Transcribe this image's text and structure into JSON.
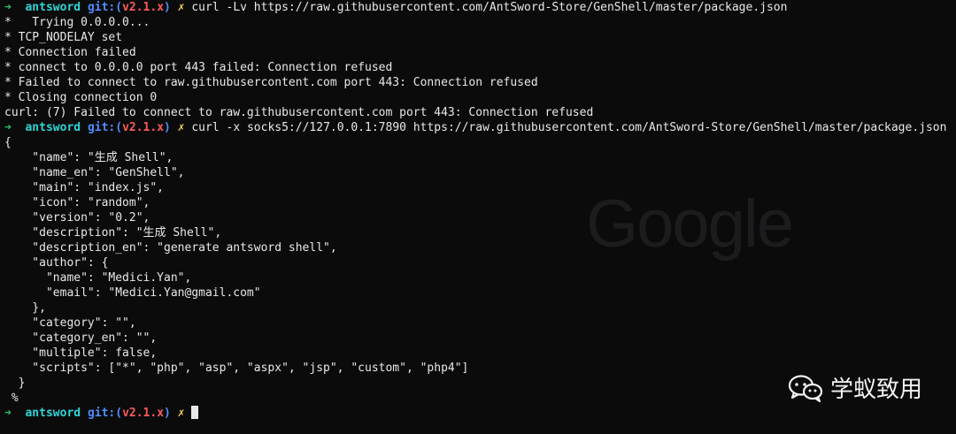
{
  "terminal": {
    "prompt": {
      "arrow": "➜",
      "user": "antsword",
      "git_label": "git:(",
      "branch": "v2.1.x",
      "git_close": ")",
      "mark": "✗"
    },
    "cmd1": "curl -Lv https://raw.githubusercontent.com/AntSword-Store/GenShell/master/package.json",
    "out1": [
      "*   Trying 0.0.0.0...",
      "* TCP_NODELAY set",
      "* Connection failed",
      "* connect to 0.0.0.0 port 443 failed: Connection refused",
      "* Failed to connect to raw.githubusercontent.com port 443: Connection refused",
      "* Closing connection 0",
      "curl: (7) Failed to connect to raw.githubusercontent.com port 443: Connection refused"
    ],
    "cmd2": "curl -x socks5://127.0.0.1:7890 https://raw.githubusercontent.com/AntSword-Store/GenShell/master/package.json",
    "out2": [
      "{",
      "    \"name\": \"生成 Shell\",",
      "    \"name_en\": \"GenShell\",",
      "    \"main\": \"index.js\",",
      "    \"icon\": \"random\",",
      "    \"version\": \"0.2\",",
      "    \"description\": \"生成 Shell\",",
      "    \"description_en\": \"generate antsword shell\",",
      "    \"author\": {",
      "      \"name\": \"Medici.Yan\",",
      "      \"email\": \"Medici.Yan@gmail.com\"",
      "    },",
      "    \"category\": \"\",",
      "    \"category_en\": \"\",",
      "    \"multiple\": false,",
      "    \"scripts\": [\"*\", \"php\", \"asp\", \"aspx\", \"jsp\", \"custom\", \"php4\"]",
      "  }",
      " %"
    ]
  },
  "background": {
    "google_logo_text": "Google"
  },
  "watermark": {
    "text": "学蚁致用"
  }
}
